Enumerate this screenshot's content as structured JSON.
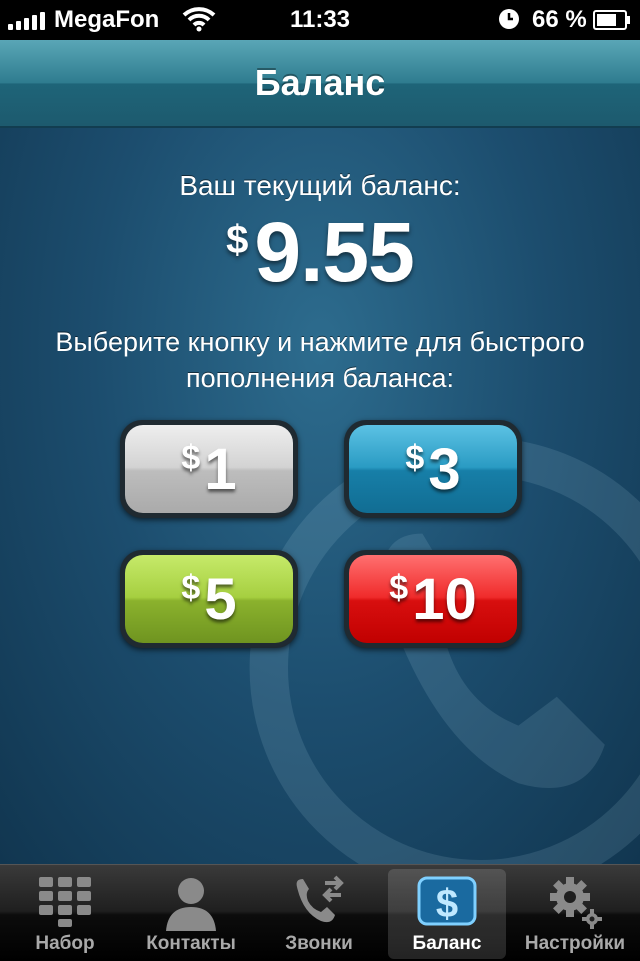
{
  "status_bar": {
    "carrier": "MegaFon",
    "time": "11:33",
    "battery_percent": "66 %",
    "icons": [
      "signal-icon",
      "wifi-icon",
      "alarm-icon",
      "battery-icon"
    ]
  },
  "nav": {
    "title": "Баланс"
  },
  "balance": {
    "label": "Ваш текущий баланс:",
    "currency": "$",
    "amount": "9.55"
  },
  "instructions": "Выберите кнопку и нажмите для быстрого пополнения баланса:",
  "topup_buttons": [
    {
      "currency": "$",
      "amount": "1",
      "color": "#bdbdbd"
    },
    {
      "currency": "$",
      "amount": "3",
      "color": "#177fa8"
    },
    {
      "currency": "$",
      "amount": "5",
      "color": "#8bb22d"
    },
    {
      "currency": "$",
      "amount": "10",
      "color": "#d80f0f"
    }
  ],
  "tabs": [
    {
      "label": "Набор",
      "icon": "keypad-icon"
    },
    {
      "label": "Контакты",
      "icon": "contact-person-icon"
    },
    {
      "label": "Звонки",
      "icon": "call-history-icon"
    },
    {
      "label": "Баланс",
      "icon": "dollar-icon",
      "active": true
    },
    {
      "label": "Настройки",
      "icon": "gear-icon"
    }
  ],
  "colors": {
    "navbar": "#2f7c8f",
    "background": "#1c4d6e",
    "tabbar": "#1f1f1f"
  }
}
